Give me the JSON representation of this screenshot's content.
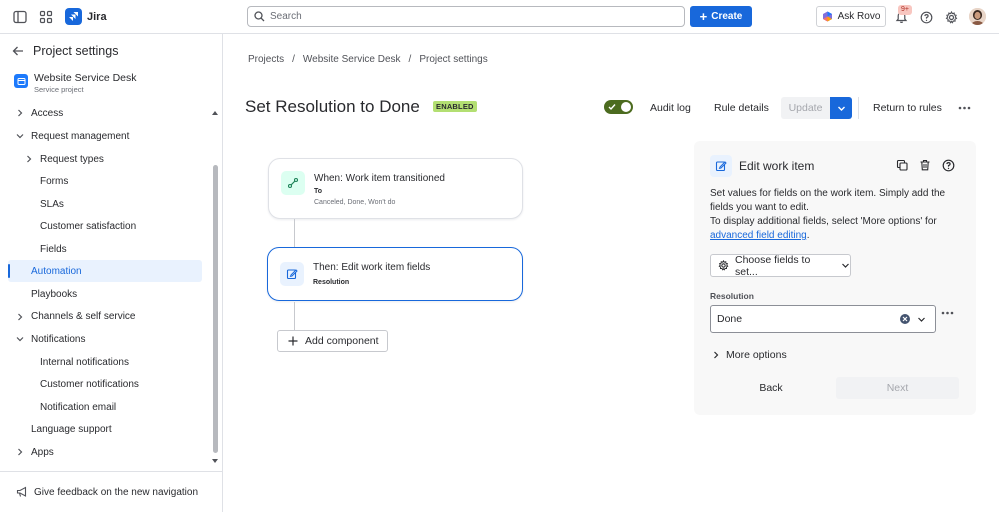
{
  "topbar": {
    "app_name": "Jira",
    "search_placeholder": "Search",
    "create_label": "Create",
    "ask_rovo_label": "Ask Rovo",
    "notification_count": "9+"
  },
  "sidebar": {
    "header": "Project settings",
    "project_name": "Website Service Desk",
    "project_type": "Service project",
    "items": [
      {
        "label": "Access",
        "chevron": "right"
      },
      {
        "label": "Request management",
        "chevron": "down"
      },
      {
        "label": "Request types",
        "chevron": "right"
      },
      {
        "label": "Forms"
      },
      {
        "label": "SLAs"
      },
      {
        "label": "Customer satisfaction"
      },
      {
        "label": "Fields"
      },
      {
        "label": "Automation",
        "active": true
      },
      {
        "label": "Playbooks"
      },
      {
        "label": "Channels & self service",
        "chevron": "right"
      },
      {
        "label": "Notifications",
        "chevron": "down"
      },
      {
        "label": "Internal notifications"
      },
      {
        "label": "Customer notifications"
      },
      {
        "label": "Notification email"
      },
      {
        "label": "Language support"
      },
      {
        "label": "Apps",
        "chevron": "right"
      }
    ],
    "feedback_label": "Give feedback on the new navigation"
  },
  "breadcrumb": [
    "Projects",
    "Website Service Desk",
    "Project settings"
  ],
  "rule": {
    "title": "Set Resolution to Done",
    "status": "ENABLED",
    "enabled": true,
    "audit_log_label": "Audit log",
    "rule_details_label": "Rule details",
    "update_label": "Update",
    "return_label": "Return to rules"
  },
  "flow": {
    "trigger": {
      "title": "When: Work item transitioned",
      "sub_label": "To",
      "sub_value": "Canceled, Done, Won't do"
    },
    "action": {
      "title": "Then: Edit work item fields",
      "sub_label": "Resolution"
    },
    "add_component_label": "Add component"
  },
  "panel": {
    "title": "Edit work item",
    "desc_line1": "Set values for fields on the work item. Simply add the fields you want to edit.",
    "desc_line2": "To display additional fields, select 'More options' for",
    "link_text": "advanced field editing",
    "choose_fields_label": "Choose fields to set...",
    "field_label": "Resolution",
    "field_value": "Done",
    "more_options_label": "More options",
    "back_label": "Back",
    "next_label": "Next"
  },
  "colors": {
    "brand": "#1868db",
    "enabled_lozenge": "#b3df72",
    "toggle_on": "#4c6b1f",
    "trigger_icon_bg": "#dcfff1",
    "active_nav_bg": "#e9f2fe"
  }
}
